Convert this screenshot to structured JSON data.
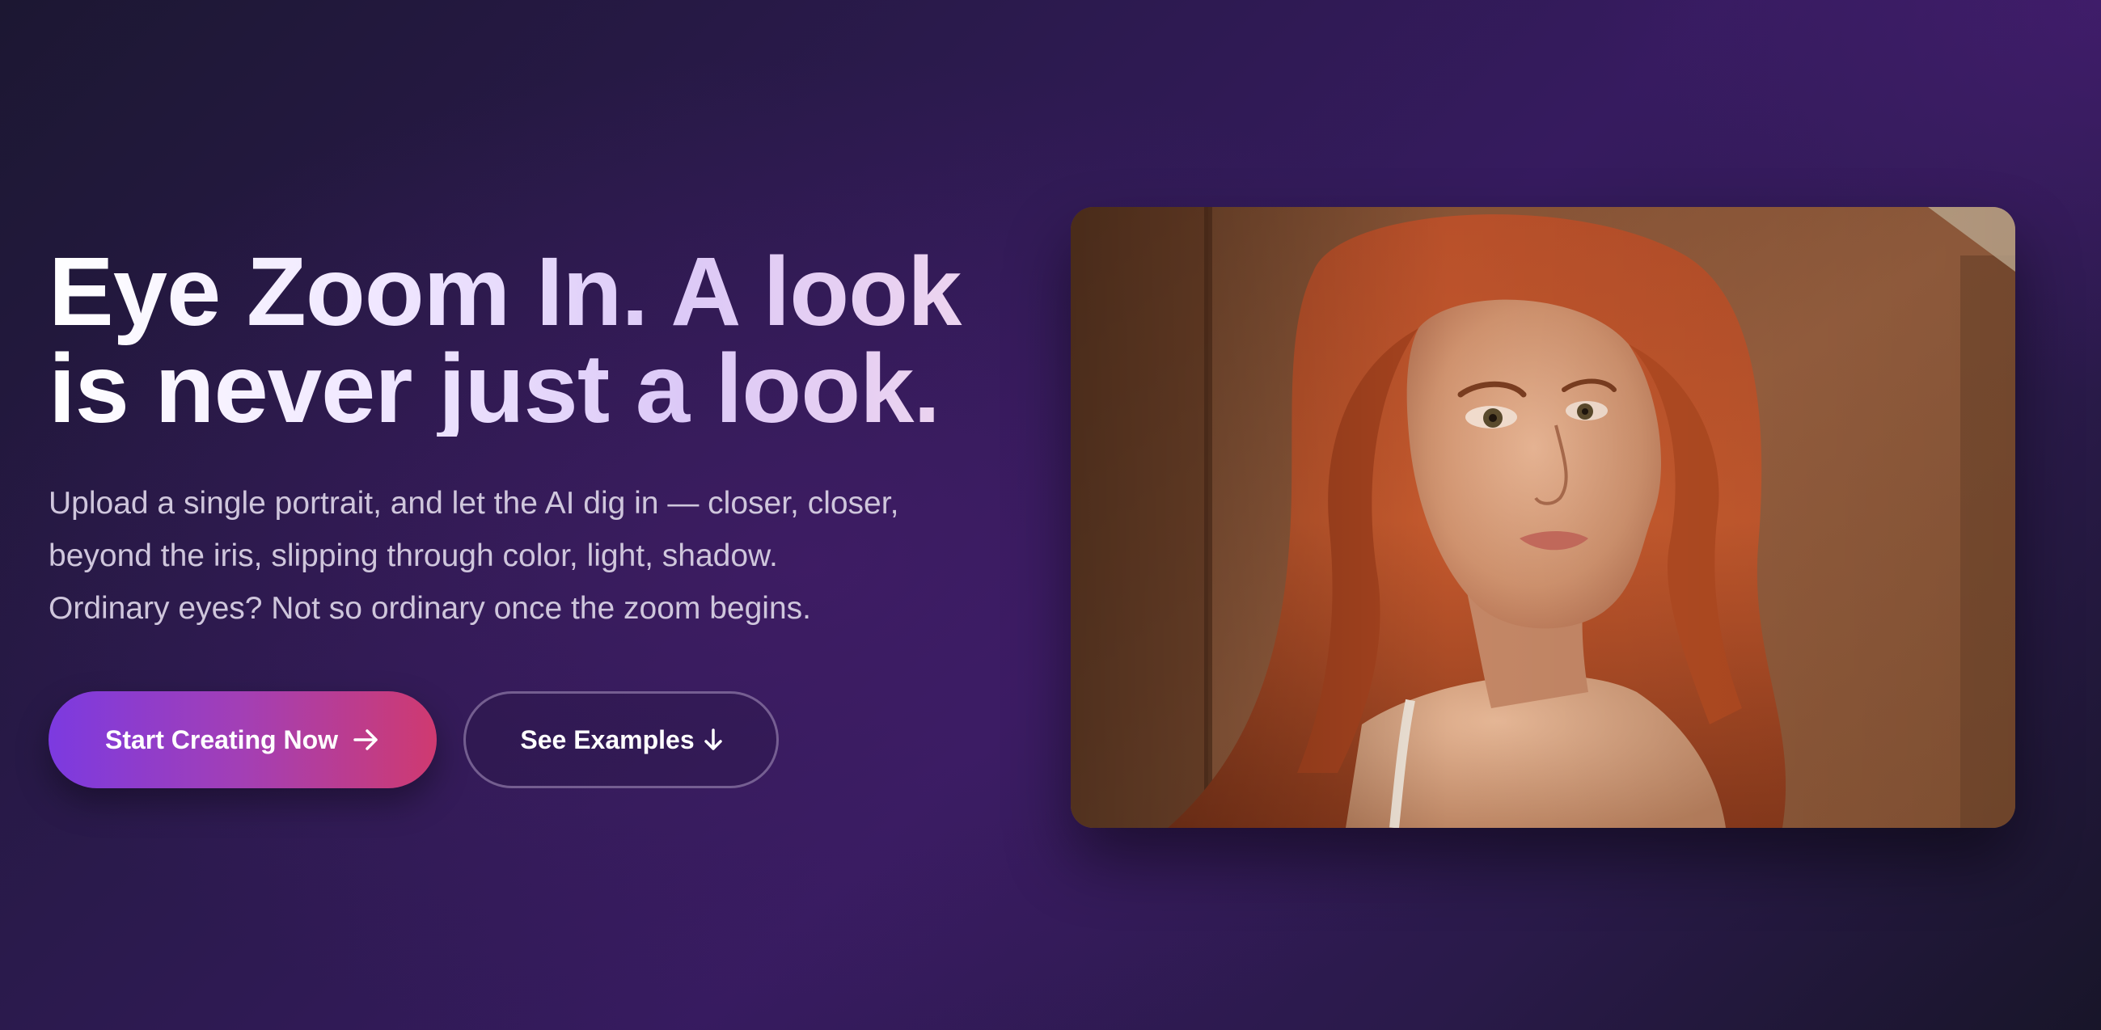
{
  "hero": {
    "title_line1": "Eye Zoom In. A look",
    "title_line2": "is never just a look.",
    "subtitle_line1": "Upload a single portrait, and let the AI dig in — closer, closer,",
    "subtitle_line2": "beyond the iris, slipping through color, light, shadow.",
    "subtitle_line3": "Ordinary eyes? Not so ordinary once the zoom begins."
  },
  "buttons": {
    "primary_label": "Start Creating Now",
    "primary_icon": "arrow-right-icon",
    "secondary_label": "See Examples",
    "secondary_icon": "arrow-down-icon"
  },
  "image": {
    "subject": "portrait of a red-haired woman looking over her shoulder"
  },
  "colors": {
    "primary_gradient_start": "#7c3ae0",
    "primary_gradient_end": "#cf3a70",
    "background_dark": "#1c1732",
    "background_purple": "#361b5f"
  }
}
